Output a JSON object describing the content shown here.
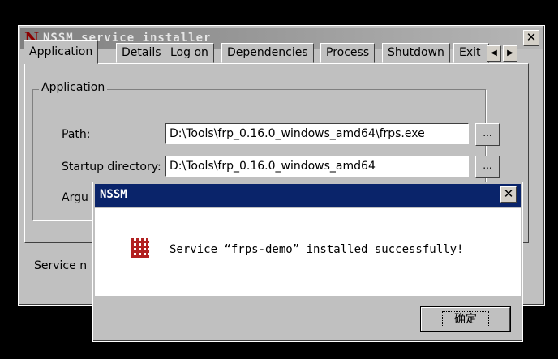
{
  "main_window": {
    "icon": "N",
    "title": "NSSM service installer",
    "close_label": "✕",
    "tabs": [
      {
        "label": "Application"
      },
      {
        "label": "Details"
      },
      {
        "label": "Log on"
      },
      {
        "label": "Dependencies"
      },
      {
        "label": "Process"
      },
      {
        "label": "Shutdown"
      },
      {
        "label": "Exit"
      }
    ],
    "tab_scroll_left": "◀",
    "tab_scroll_right": "▶",
    "group_label": "Application",
    "path_label": "Path:",
    "path_value": "D:\\Tools\\frp_0.16.0_windows_amd64\\frps.exe",
    "startup_label": "Startup directory:",
    "startup_value": "D:\\Tools\\frp_0.16.0_windows_amd64",
    "arguments_label": "Argu",
    "browse_label": "...",
    "service_name_label": "Service n"
  },
  "dialog": {
    "title": "NSSM",
    "close_label": "✕",
    "message": "Service “frps-demo” installed successfully!",
    "ok_label": "确定"
  }
}
